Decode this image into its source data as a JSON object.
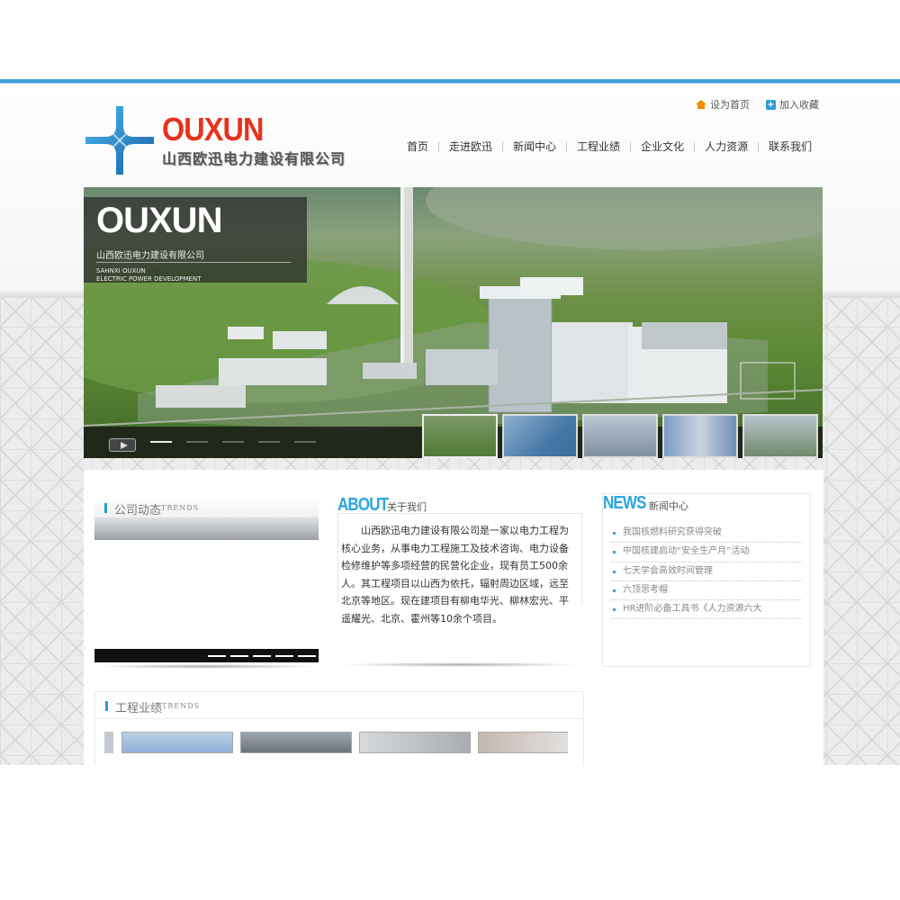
{
  "topbar": {
    "home_label": "设为首页",
    "fav_label": "加入收藏"
  },
  "logo": {
    "brand": "OUXUN",
    "company": "山西欧迅电力建设有限公司"
  },
  "nav": {
    "items": [
      "首页",
      "走进欧迅",
      "新闻中心",
      "工程业绩",
      "企业文化",
      "人力资源",
      "联系我们"
    ]
  },
  "banner": {
    "brand": "OUXUN",
    "company": "山西欧迅电力建设有限公司",
    "en_line1": "SAHNXI OUXUN",
    "en_line2": "ELECTRIC POWER DEVELOPMENT"
  },
  "trends": {
    "title": "公司动态",
    "tag": "TRENDS"
  },
  "about": {
    "title": "ABOUT",
    "subtitle": "关于我们",
    "text": "山西欧迅电力建设有限公司是一家以电力工程为核心业务，从事电力工程施工及技术咨询、电力设备检修维护等多项经营的民营化企业，现有员工500余人。其工程项目以山西为依托，辐射周边区域，远至北京等地区。现在建项目有柳电华光、柳林宏光、平遥耀光、北京、霍州等10余个项目。"
  },
  "news": {
    "title": "NEWS",
    "subtitle": "新闻中心",
    "items": [
      "我国核燃料研究获得突破",
      "中国核建启动“安全生产月”活动",
      "七天学会高效时间管理",
      "六顶思考帽",
      "HR进阶必备工具书《人力资源六大"
    ]
  },
  "projects": {
    "title": "工程业绩",
    "tag": "TRENDS"
  },
  "colors": {
    "accent": "#2aa5e0",
    "brand_red": "#e8321c",
    "top_line": "#3ea0d8"
  }
}
